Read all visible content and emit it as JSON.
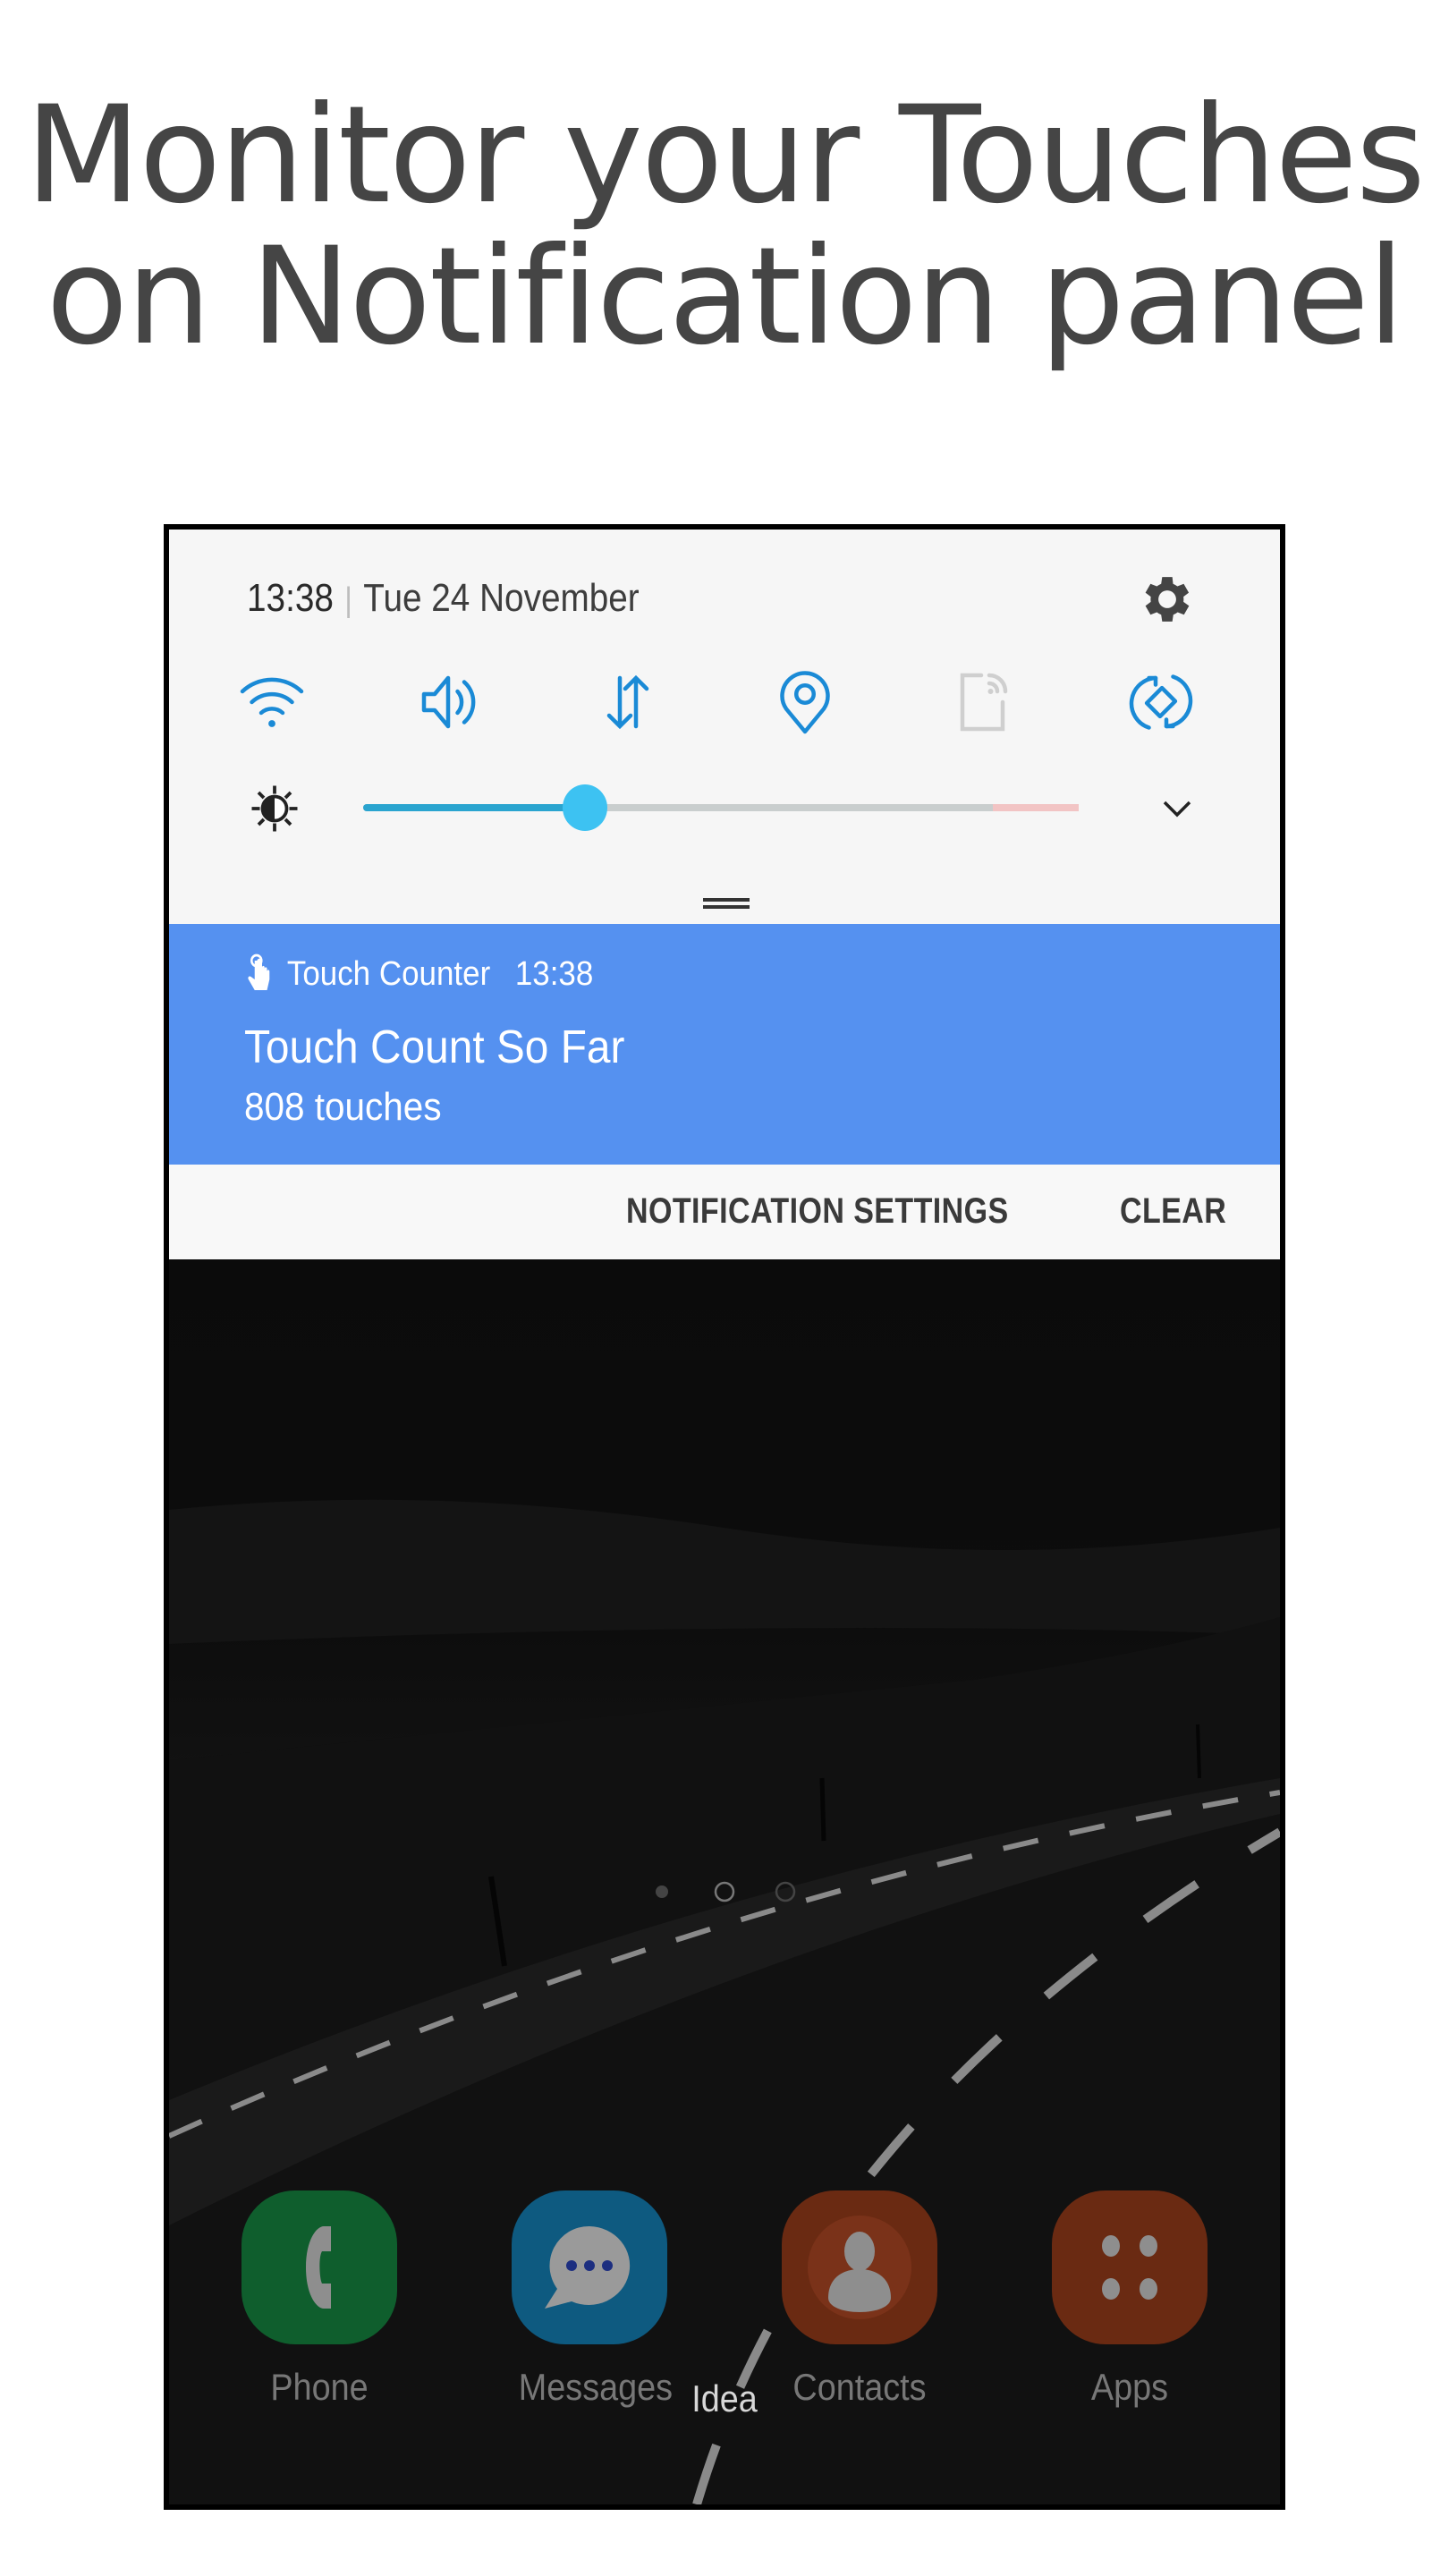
{
  "headline": {
    "line1": "Monitor your Touches",
    "line2": "on Notification panel"
  },
  "status": {
    "time": "13:38",
    "separator": "|",
    "date": "Tue 24 November",
    "settings_icon": "gear-icon"
  },
  "quick_settings": {
    "tiles": [
      {
        "name": "wifi",
        "icon": "wifi-icon",
        "active": true
      },
      {
        "name": "sound",
        "icon": "speaker-icon",
        "active": true
      },
      {
        "name": "mobile-data",
        "icon": "data-arrows-icon",
        "active": true
      },
      {
        "name": "location",
        "icon": "location-pin-icon",
        "active": true
      },
      {
        "name": "nfc",
        "icon": "nfc-icon",
        "active": false
      },
      {
        "name": "auto-rotate",
        "icon": "rotate-icon",
        "active": true
      }
    ],
    "active_color": "#1a8ad6",
    "inactive_color": "#cfcfcf",
    "brightness": {
      "icon": "brightness-icon",
      "value_fraction": 0.31,
      "warning_from_fraction": 0.88,
      "expand_icon": "chevron-down-icon"
    }
  },
  "notification": {
    "app_icon": "touch-hand-icon",
    "app_name": "Touch Counter",
    "time": "13:38",
    "title": "Touch Count So Far",
    "body": "808 touches",
    "background": "#5591f0"
  },
  "notification_actions": {
    "settings_label": "NOTIFICATION SETTINGS",
    "clear_label": "CLEAR"
  },
  "home": {
    "page_indicator": {
      "pages": 3,
      "current": 2
    },
    "dock": [
      {
        "label": "Phone",
        "icon": "phone-icon",
        "color": "#0f5e2d"
      },
      {
        "label": "Messages",
        "icon": "message-bubble-icon",
        "color": "#0e5a80"
      },
      {
        "label": "Contacts",
        "icon": "contact-person-icon",
        "color": "#6a2a12"
      },
      {
        "label": "Apps",
        "icon": "apps-grid-icon",
        "color": "#6a2a12"
      }
    ],
    "carrier": "Idea"
  }
}
